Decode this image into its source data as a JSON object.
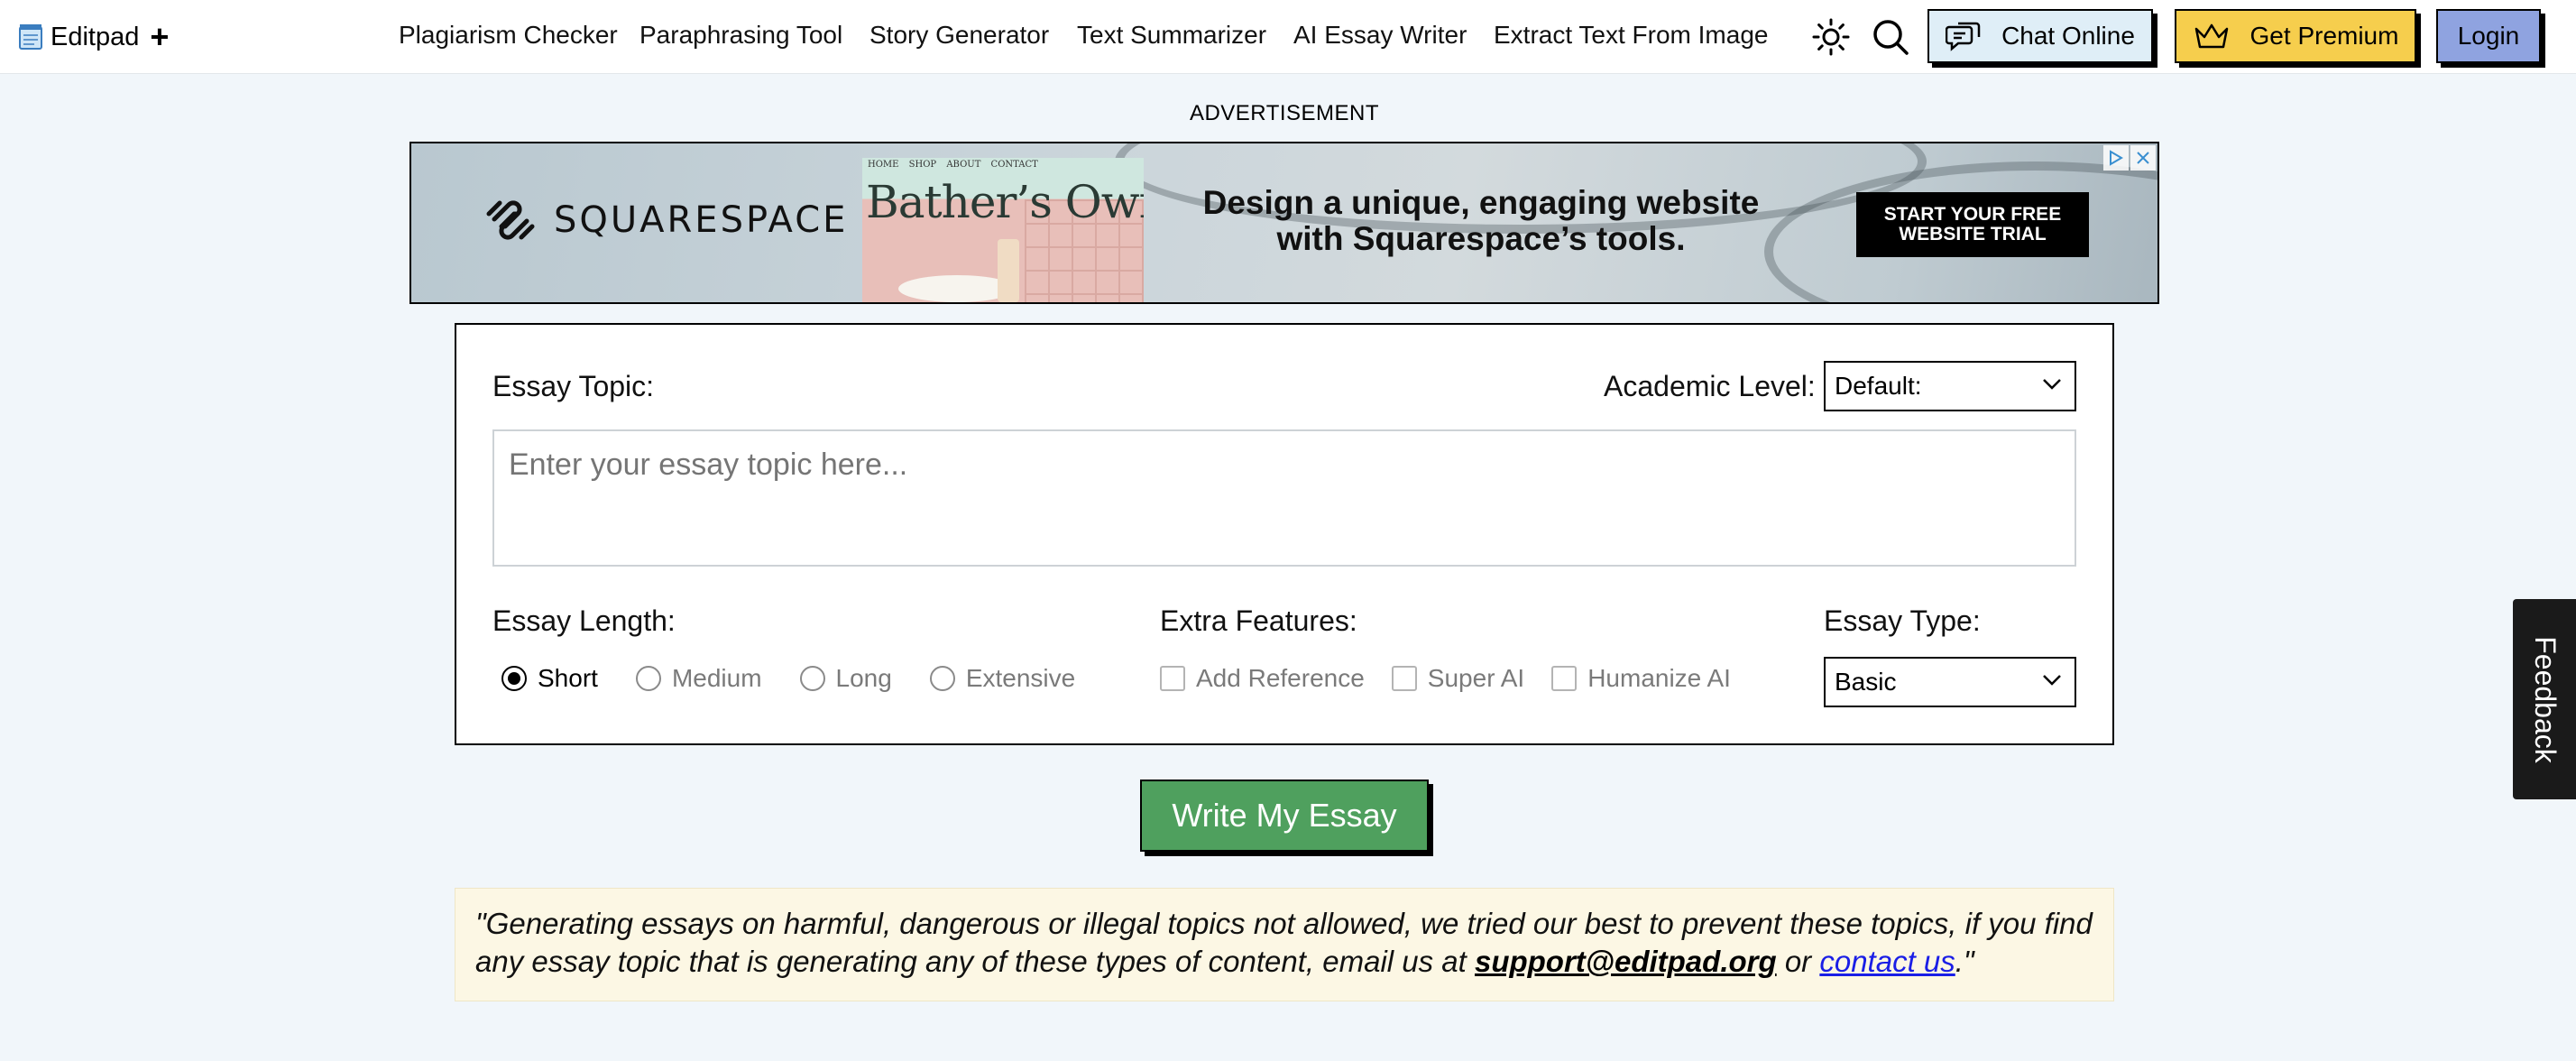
{
  "header": {
    "logo_text": "Editpad",
    "logo_plus": "+",
    "nav": [
      "Plagiarism Checker",
      "Paraphrasing Tool",
      "Story Generator",
      "Text Summarizer",
      "AI Essay Writer",
      "Extract Text From Image"
    ],
    "icons": [
      "sun-icon",
      "search-icon"
    ],
    "chat_label": "Chat Online",
    "premium_label": "Get Premium",
    "login_label": "Login"
  },
  "ad": {
    "label": "ADVERTISEMENT",
    "brand": "SQUARESPACE",
    "photo_nav": "HOME SHOP ABOUT CONTACT",
    "photo_title": "Bather’s Own",
    "headline_1": "Design a unique, engaging website",
    "headline_2": "with Squarespace’s tools.",
    "cta_1": "START YOUR FREE",
    "cta_2": "WEBSITE TRIAL"
  },
  "form": {
    "topic_label": "Essay Topic:",
    "academic_label": "Academic Level:",
    "academic_value": "Default:",
    "topic_placeholder": "Enter your essay topic here...",
    "length_label": "Essay Length:",
    "length_options": [
      "Short",
      "Medium",
      "Long",
      "Extensive"
    ],
    "length_selected": "Short",
    "features_label": "Extra Features:",
    "features": [
      "Add Reference",
      "Super AI",
      "Humanize AI"
    ],
    "type_label": "Essay Type:",
    "type_value": "Basic"
  },
  "submit_label": "Write My Essay",
  "notice": {
    "text_1": "\"Generating essays on harmful, dangerous or illegal topics not allowed, we tried our best to prevent these topics, if you find any essay topic that is generating any of these types of content, email us at ",
    "email": "support@editpad.org",
    "text_2": " or ",
    "link": "contact us",
    "text_3": ".\""
  },
  "feedback_label": "Feedback"
}
